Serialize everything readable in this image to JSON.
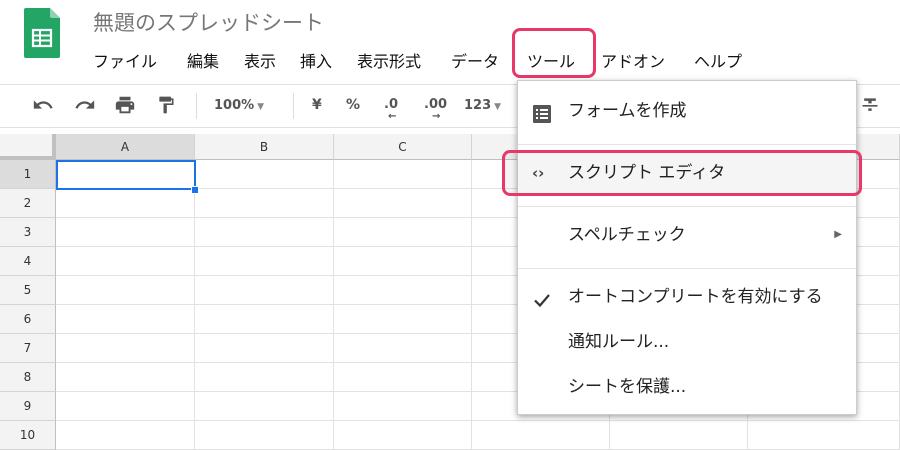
{
  "app": {
    "title": "無題のスプレッドシート"
  },
  "menubar": {
    "items": [
      "ファイル",
      "編集",
      "表示",
      "挿入",
      "表示形式",
      "データ",
      "ツール",
      "アドオン",
      "ヘルプ"
    ]
  },
  "toolbar": {
    "zoom": "100%",
    "currency": "¥",
    "percent": "%",
    "decrease_decimal": ".0",
    "increase_decimal": ".00",
    "number_format": "123"
  },
  "grid": {
    "columns": [
      "A",
      "B",
      "C"
    ],
    "rows": [
      "1",
      "2",
      "3",
      "4",
      "5",
      "6",
      "7",
      "8",
      "9",
      "10"
    ],
    "selected_cell": "A1"
  },
  "tools_menu": {
    "items": [
      {
        "label": "フォームを作成",
        "icon": "form-icon"
      },
      {
        "label": "スクリプト エディタ",
        "icon": "code-icon"
      },
      {
        "label": "スペルチェック",
        "icon": "submenu-arrow-icon"
      },
      {
        "label": "オートコンプリートを有効にする",
        "icon": "check-icon"
      },
      {
        "label": "通知ルール...",
        "icon": ""
      },
      {
        "label": "シートを保護...",
        "icon": ""
      }
    ]
  },
  "colors": {
    "highlight": "#e8386a",
    "selection": "#1a73e8",
    "sheets_green": "#23a566"
  }
}
